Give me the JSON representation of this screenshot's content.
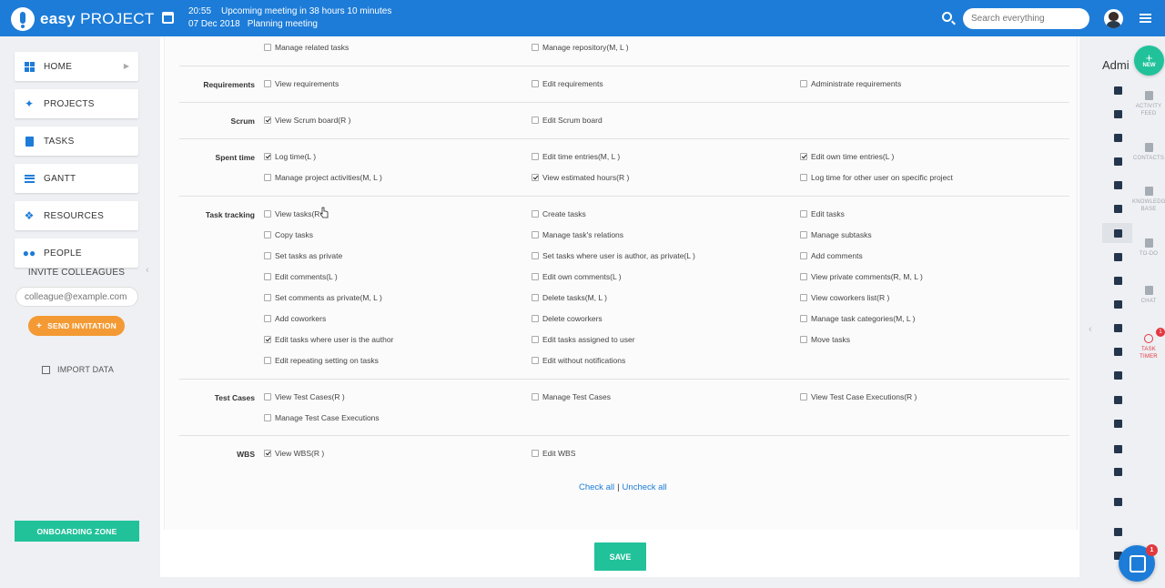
{
  "header": {
    "logo_bold": "easy",
    "logo_rest": "PROJECT",
    "meeting_time": "20:55",
    "meeting_text": "Upcoming meeting in 38 hours 10 minutes",
    "meeting_date": "07 Dec 2018",
    "meeting_name": "Planning meeting",
    "search_placeholder": "Search everything"
  },
  "sidebar": {
    "items": [
      {
        "label": "HOME",
        "icon": "grid-icon"
      },
      {
        "label": "PROJECTS",
        "icon": "network-icon"
      },
      {
        "label": "TASKS",
        "icon": "clipboard-icon"
      },
      {
        "label": "GANTT",
        "icon": "list-icon"
      },
      {
        "label": "RESOURCES",
        "icon": "dropbox-icon"
      },
      {
        "label": "PEOPLE",
        "icon": "people-icon"
      }
    ],
    "invite_title": "INVITE COLLEAGUES",
    "invite_placeholder": "colleague@example.com",
    "send_label": "SEND INVITATION",
    "import_label": "IMPORT DATA",
    "onboarding_label": "ONBOARDING ZONE"
  },
  "permissions": {
    "top_row": [
      {
        "label": "Manage related tasks",
        "checked": false
      },
      {
        "label": "Manage repository(M, L )",
        "checked": false
      }
    ],
    "groups": [
      {
        "name": "Requirements",
        "rows": [
          [
            {
              "label": "View requirements",
              "checked": false
            },
            {
              "label": "Edit requirements",
              "checked": false
            },
            {
              "label": "Administrate requirements",
              "checked": false
            }
          ]
        ]
      },
      {
        "name": "Scrum",
        "rows": [
          [
            {
              "label": "View Scrum board(R )",
              "checked": true
            },
            {
              "label": "Edit Scrum board",
              "checked": false
            }
          ]
        ]
      },
      {
        "name": "Spent time",
        "rows": [
          [
            {
              "label": "Log time(L )",
              "checked": true
            },
            {
              "label": "Edit time entries(M, L )",
              "checked": false
            },
            {
              "label": "Edit own time entries(L )",
              "checked": true
            }
          ],
          [
            {
              "label": "Manage project activities(M, L )",
              "checked": false
            },
            {
              "label": "View estimated hours(R )",
              "checked": true
            },
            {
              "label": "Log time for other user on specific project",
              "checked": false
            }
          ]
        ]
      },
      {
        "name": "Task tracking",
        "rows": [
          [
            {
              "label": "View tasks(R",
              "checked": false
            },
            {
              "label": "Create tasks",
              "checked": false
            },
            {
              "label": "Edit tasks",
              "checked": false
            }
          ],
          [
            {
              "label": "Copy tasks",
              "checked": false
            },
            {
              "label": "Manage task's relations",
              "checked": false
            },
            {
              "label": "Manage subtasks",
              "checked": false
            }
          ],
          [
            {
              "label": "Set tasks as private",
              "checked": false
            },
            {
              "label": "Set tasks where user is author, as private(L )",
              "checked": false
            },
            {
              "label": "Add comments",
              "checked": false
            }
          ],
          [
            {
              "label": "Edit comments(L )",
              "checked": false
            },
            {
              "label": "Edit own comments(L )",
              "checked": false
            },
            {
              "label": "View private comments(R, M, L )",
              "checked": false
            }
          ],
          [
            {
              "label": "Set comments as private(M, L )",
              "checked": false
            },
            {
              "label": "Delete tasks(M, L )",
              "checked": false
            },
            {
              "label": "View coworkers list(R )",
              "checked": false
            }
          ],
          [
            {
              "label": "Add coworkers",
              "checked": false
            },
            {
              "label": "Delete coworkers",
              "checked": false
            },
            {
              "label": "Manage task categories(M, L )",
              "checked": false
            }
          ],
          [
            {
              "label": "Edit tasks where user is the author",
              "checked": true
            },
            {
              "label": "Edit tasks assigned to user",
              "checked": false
            },
            {
              "label": "Move tasks",
              "checked": false
            }
          ],
          [
            {
              "label": "Edit repeating setting on tasks",
              "checked": false
            },
            {
              "label": "Edit without notifications",
              "checked": false
            }
          ]
        ]
      },
      {
        "name": "Test Cases",
        "rows": [
          [
            {
              "label": "View Test Cases(R )",
              "checked": false
            },
            {
              "label": "Manage Test Cases",
              "checked": false
            },
            {
              "label": "View Test Case Executions(R )",
              "checked": false
            }
          ],
          [
            {
              "label": "Manage Test Case Executions",
              "checked": false
            }
          ]
        ]
      },
      {
        "name": "WBS",
        "rows": [
          [
            {
              "label": "View WBS(R )",
              "checked": true
            },
            {
              "label": "Edit WBS",
              "checked": false
            }
          ]
        ]
      }
    ],
    "check_all": "Check all",
    "separator": "|",
    "uncheck_all": "Uncheck all",
    "save_label": "SAVE"
  },
  "right_sidebar": {
    "admin_label": "Admi",
    "new_label": "NEW",
    "tools": [
      {
        "label": "ACTIVITY FEED"
      },
      {
        "label": "CONTACTS"
      },
      {
        "label": "KNOWLEDGE BASE"
      },
      {
        "label": "TO-DO"
      },
      {
        "label": "CHAT"
      },
      {
        "label": "TASK TIMER"
      }
    ],
    "timer_badge": "1",
    "chat_badge": "1"
  },
  "colors": {
    "brand_blue": "#1d7cd8",
    "accent_green": "#21c29a",
    "accent_orange": "#f49a34",
    "alert_red": "#e2383f"
  }
}
